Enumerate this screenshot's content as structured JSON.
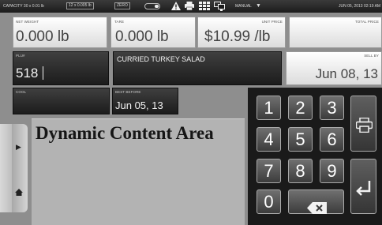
{
  "status_bar": {
    "capacity": "CAPACITY 30 x 0.01 lb",
    "capacity_box": "12 x 0.005 lb",
    "zero": "ZERO",
    "manual": "MANUAL",
    "datetime": "JUN 05, 2013 02:19 AM"
  },
  "fields": {
    "net_weight": {
      "label": "NET WEIGHT",
      "value": "0.000 lb"
    },
    "tare": {
      "label": "TARE",
      "value": "0.000 lb"
    },
    "unit_price": {
      "label": "UNIT PRICE",
      "value": "$10.99 /lb"
    },
    "total_price": {
      "label": "TOTAL PRICE",
      "value": ""
    },
    "plu": {
      "label": "PLU#",
      "value": "518"
    },
    "description": {
      "value": "CURRIED TURKEY SALAD"
    },
    "sell_by": {
      "label": "SELL BY",
      "value": "Jun 08, 13"
    },
    "cool": {
      "label": "COOL",
      "value": ""
    },
    "best_before": {
      "label": "BEST BEFORE",
      "value": "Jun 05, 13"
    }
  },
  "keypad": {
    "keys": [
      "1",
      "2",
      "3",
      "4",
      "5",
      "6",
      "7",
      "8",
      "9",
      "0"
    ],
    "backspace_icon": "backspace-icon",
    "print_icon": "printer-icon",
    "enter_icon": "enter-icon"
  },
  "dynamic_area": {
    "text": "Dynamic Content Area"
  },
  "icons": [
    "warning-icon",
    "printer-icon",
    "grid-icon",
    "network-icon",
    "chevron-right-icon",
    "home-icon"
  ],
  "colors": {
    "background": "#8e8e8e",
    "dark_panel": "#2a2a2a",
    "light_panel": "#eeeeee",
    "keypad": "#1a1a1a"
  }
}
